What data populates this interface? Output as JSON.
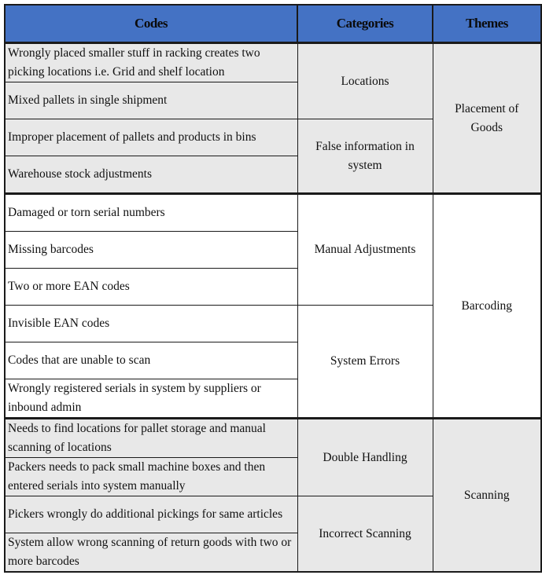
{
  "table": {
    "headers": {
      "codes": "Codes",
      "categories": "Categories",
      "themes": "Themes"
    },
    "colors": {
      "header_bg": "#4472C4",
      "gray_band": "#E8E8E8",
      "white_band": "#FFFFFF",
      "border": "#1A1A1A"
    },
    "themes": [
      {
        "theme": "Placement of Goods",
        "shade": "gray",
        "categories": [
          {
            "category": "Locations",
            "codes": [
              "Wrongly placed smaller stuff in racking creates two picking locations i.e. Grid and shelf location",
              "Mixed pallets in single shipment"
            ]
          },
          {
            "category": "False information in system",
            "codes": [
              "Improper placement of pallets and products in bins",
              "Warehouse stock adjustments"
            ]
          }
        ]
      },
      {
        "theme": "Barcoding",
        "shade": "white",
        "categories": [
          {
            "category": "Manual Adjustments",
            "codes": [
              "Damaged or torn serial numbers",
              "Missing barcodes",
              "Two or more EAN codes"
            ]
          },
          {
            "category": "System Errors",
            "codes": [
              "Invisible EAN codes",
              "Codes that are unable to scan",
              "Wrongly registered serials in system by suppliers or inbound admin"
            ]
          }
        ]
      },
      {
        "theme": "Scanning",
        "shade": "gray",
        "categories": [
          {
            "category": "Double Handling",
            "codes": [
              "Needs to find locations for pallet storage and manual scanning of locations",
              "Packers needs to pack small machine boxes and then entered serials into system manually"
            ]
          },
          {
            "category": "Incorrect Scanning",
            "codes": [
              "Pickers wrongly do additional pickings for same articles",
              "System allow wrong scanning of return goods with two or more barcodes"
            ]
          }
        ]
      }
    ]
  }
}
